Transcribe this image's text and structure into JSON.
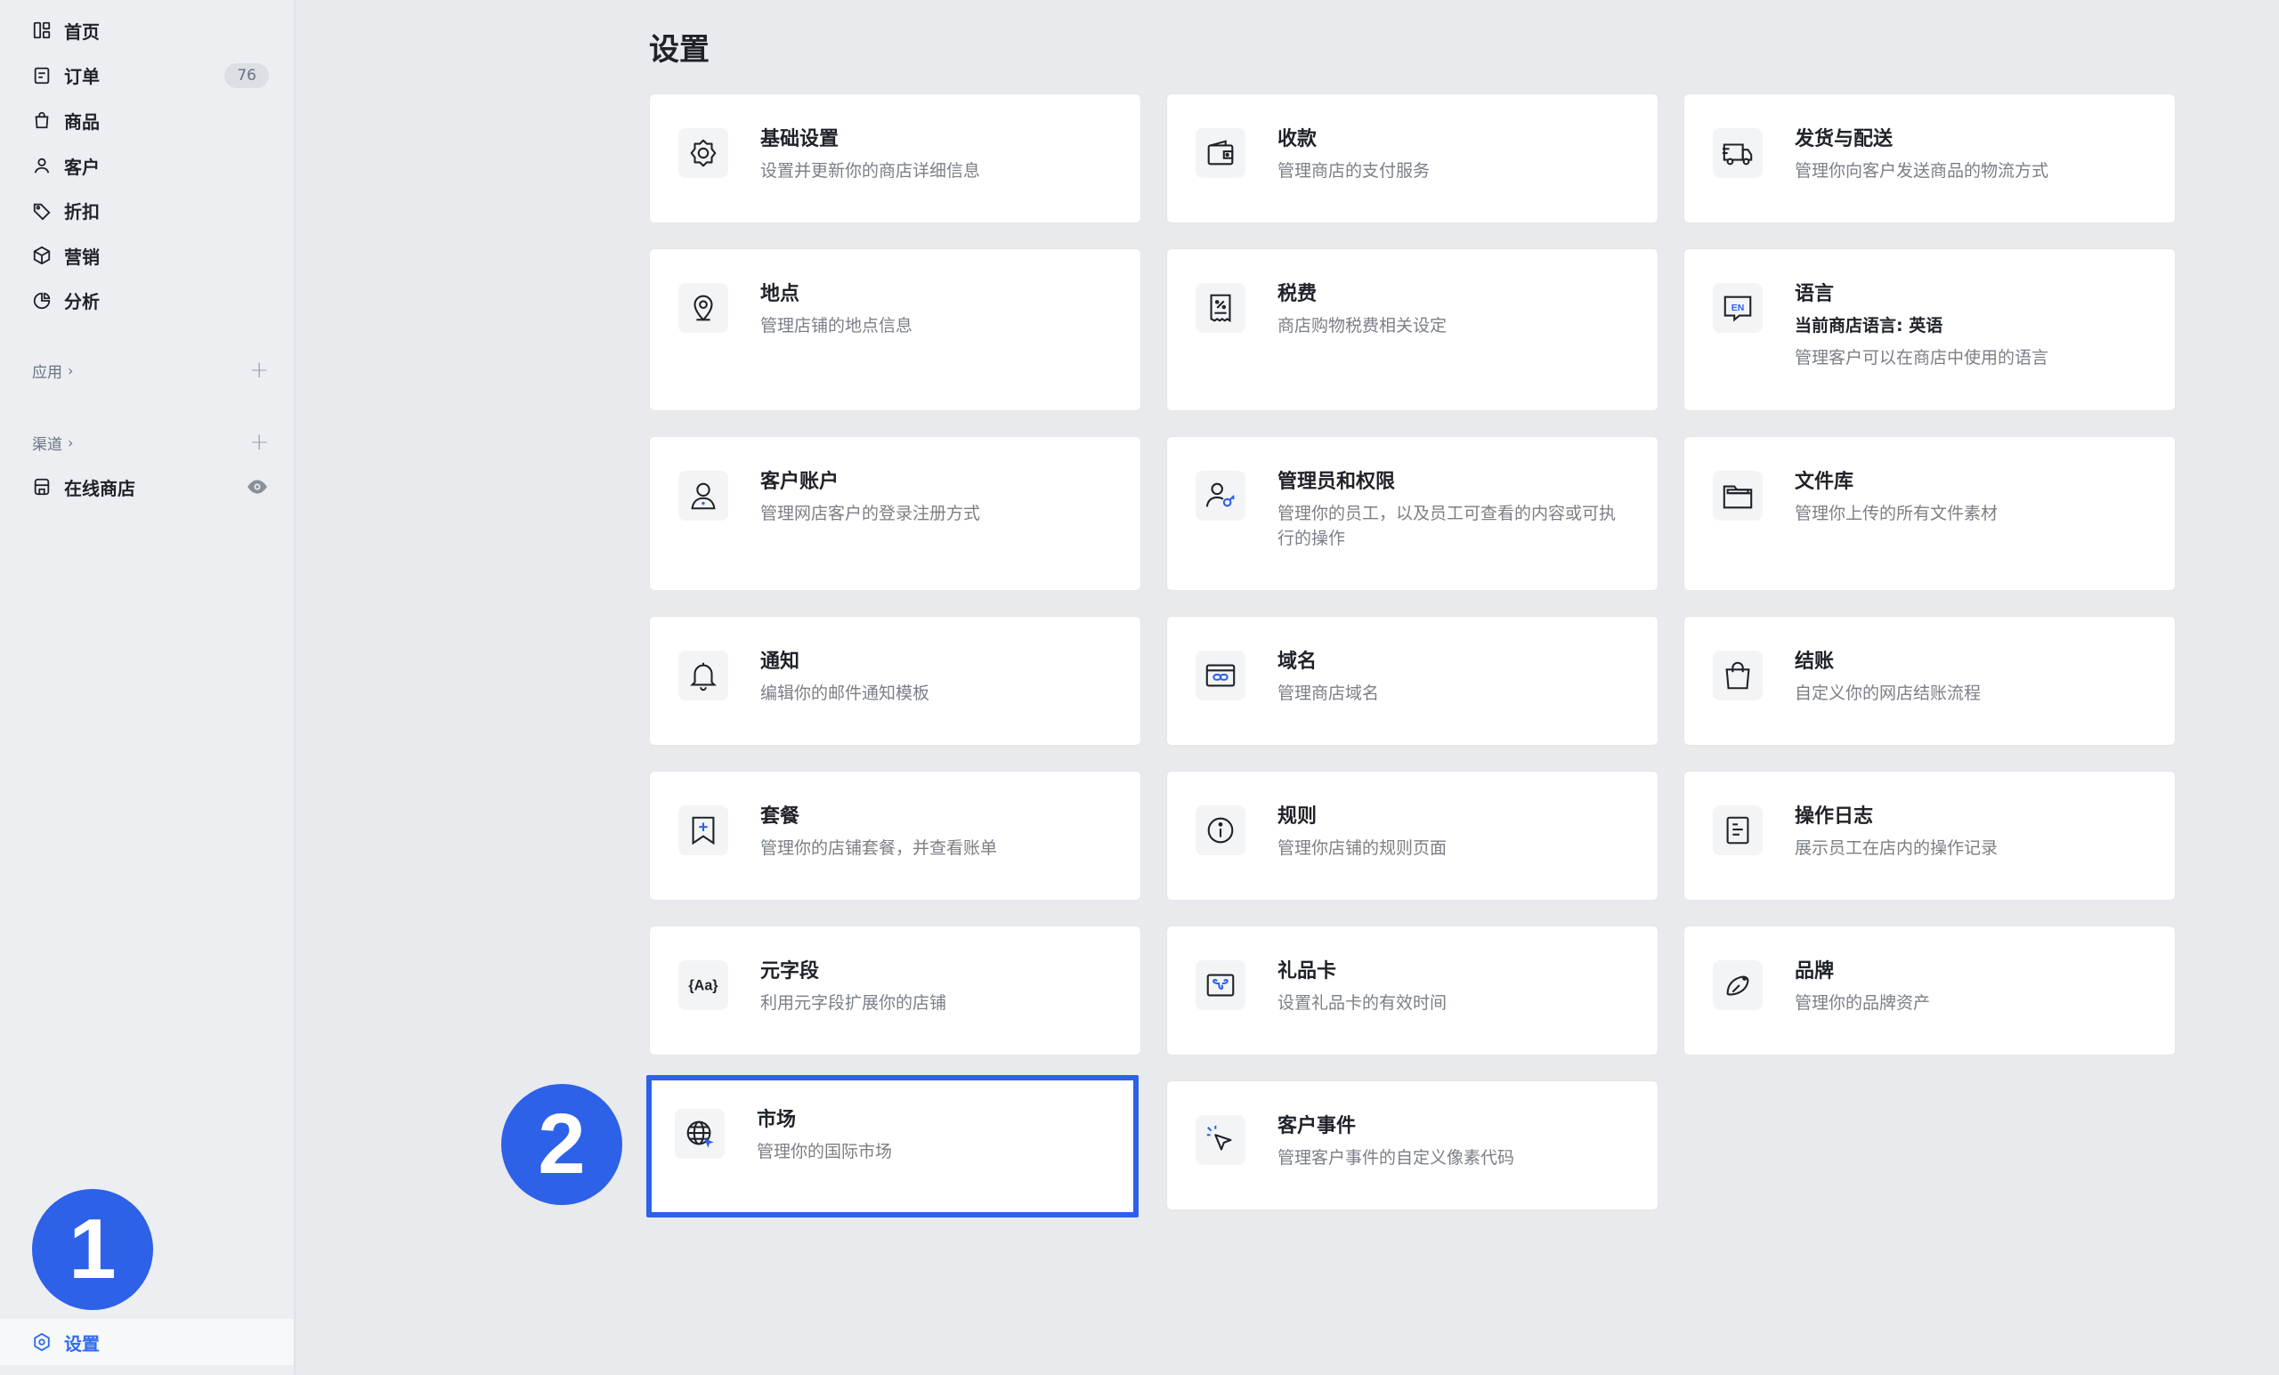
{
  "sidebar": {
    "nav": [
      {
        "label": "首页",
        "icon": "dashboard-icon"
      },
      {
        "label": "订单",
        "icon": "order-icon",
        "badge": "76"
      },
      {
        "label": "商品",
        "icon": "bag-icon"
      },
      {
        "label": "客户",
        "icon": "person-icon"
      },
      {
        "label": "折扣",
        "icon": "tag-icon"
      },
      {
        "label": "营销",
        "icon": "cube-icon"
      },
      {
        "label": "分析",
        "icon": "pie-chart-icon"
      }
    ],
    "apps_label": "应用",
    "channels_label": "渠道",
    "online_store": "在线商店",
    "settings_label": "设置"
  },
  "markers": {
    "one": "1",
    "two": "2"
  },
  "main": {
    "title": "设置",
    "cards": [
      {
        "title": "基础设置",
        "desc": "设置并更新你的商店详细信息",
        "icon": "gear-icon"
      },
      {
        "title": "收款",
        "desc": "管理商店的支付服务",
        "icon": "wallet-icon"
      },
      {
        "title": "发货与配送",
        "desc": "管理你向客户发送商品的物流方式",
        "icon": "truck-icon"
      },
      {
        "title": "地点",
        "desc": "管理店铺的地点信息",
        "icon": "location-pin-icon"
      },
      {
        "title": "税费",
        "desc": "商店购物税费相关设定",
        "icon": "tax-receipt-icon"
      },
      {
        "title": "语言",
        "subtitle": "当前商店语言: 英语",
        "desc": "管理客户可以在商店中使用的语言",
        "icon": "language-en-icon"
      },
      {
        "title": "客户账户",
        "desc": "管理网店客户的登录注册方式",
        "icon": "customer-account-icon"
      },
      {
        "title": "管理员和权限",
        "desc": "管理你的员工，以及员工可查看的内容或可执行的操作",
        "icon": "admin-key-icon"
      },
      {
        "title": "文件库",
        "desc": "管理你上传的所有文件素材",
        "icon": "folder-icon"
      },
      {
        "title": "通知",
        "desc": "编辑你的邮件通知模板",
        "icon": "bell-icon"
      },
      {
        "title": "域名",
        "desc": "管理商店域名",
        "icon": "domain-link-icon"
      },
      {
        "title": "结账",
        "desc": "自定义你的网店结账流程",
        "icon": "shopping-bag-icon"
      },
      {
        "title": "套餐",
        "desc": "管理你的店铺套餐，并查看账单",
        "icon": "plan-bookmark-icon"
      },
      {
        "title": "规则",
        "desc": "管理你店铺的规则页面",
        "icon": "info-icon"
      },
      {
        "title": "操作日志",
        "desc": "展示员工在店内的操作记录",
        "icon": "log-document-icon"
      },
      {
        "title": "元字段",
        "desc": "利用元字段扩展你的店铺",
        "icon": "metafield-icon"
      },
      {
        "title": "礼品卡",
        "desc": "设置礼品卡的有效时间",
        "icon": "gift-card-icon"
      },
      {
        "title": "品牌",
        "desc": "管理你的品牌资产",
        "icon": "brand-icon"
      },
      {
        "title": "市场",
        "desc": "管理你的国际市场",
        "icon": "globe-icon"
      },
      {
        "title": "客户事件",
        "desc": "管理客户事件的自定义像素代码",
        "icon": "cursor-click-icon"
      }
    ]
  }
}
